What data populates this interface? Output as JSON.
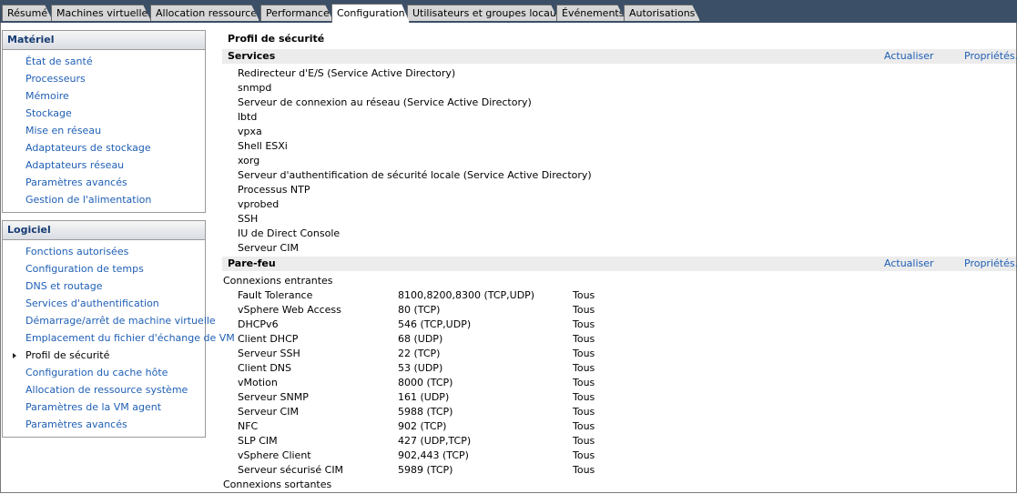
{
  "tabs": [
    {
      "label": "Résumé",
      "active": false
    },
    {
      "label": "Machines virtuelles",
      "active": false
    },
    {
      "label": "Allocation ressources",
      "active": false
    },
    {
      "label": "Performance",
      "active": false
    },
    {
      "label": "Configuration",
      "active": true
    },
    {
      "label": "Utilisateurs et groupes locaux",
      "active": false
    },
    {
      "label": "Événements",
      "active": false
    },
    {
      "label": "Autorisations",
      "active": false
    }
  ],
  "sidebar": {
    "hardware": {
      "title": "Matériel",
      "items": [
        "État de santé",
        "Processeurs",
        "Mémoire",
        "Stockage",
        "Mise en réseau",
        "Adaptateurs de stockage",
        "Adaptateurs réseau",
        "Paramètres avancés",
        "Gestion de l'alimentation"
      ]
    },
    "software": {
      "title": "Logiciel",
      "items": [
        "Fonctions autorisées",
        "Configuration de temps",
        "DNS et routage",
        "Services d'authentification",
        "Démarrage/arrêt de machine virtuelle",
        "Emplacement du fichier d'échange de VM",
        "Profil de sécurité",
        "Configuration du cache hôte",
        "Allocation de ressource système",
        "Paramètres de la VM agent",
        "Paramètres avancés"
      ],
      "selected_index": 6
    }
  },
  "content": {
    "title": "Profil de sécurité",
    "services": {
      "heading": "Services",
      "refresh_label": "Actualiser",
      "properties_label": "Propriétés...",
      "items": [
        "Redirecteur d'E/S (Service Active Directory)",
        "snmpd",
        "Serveur de connexion au réseau (Service Active Directory)",
        "lbtd",
        "vpxa",
        "Shell ESXi",
        "xorg",
        "Serveur d'authentification de sécurité locale (Service Active Directory)",
        "Processus NTP",
        "vprobed",
        "SSH",
        "IU de Direct Console",
        "Serveur CIM"
      ]
    },
    "firewall": {
      "heading": "Pare-feu",
      "refresh_label": "Actualiser",
      "properties_label": "Propriétés...",
      "incoming_label": "Connexions entrantes",
      "outgoing_label": "Connexions sortantes",
      "incoming": [
        {
          "name": "Fault Tolerance",
          "ports": "8100,8200,8300 (TCP,UDP)",
          "scope": "Tous"
        },
        {
          "name": "vSphere Web Access",
          "ports": "80 (TCP)",
          "scope": "Tous"
        },
        {
          "name": "DHCPv6",
          "ports": "546 (TCP,UDP)",
          "scope": "Tous"
        },
        {
          "name": "Client DHCP",
          "ports": "68 (UDP)",
          "scope": "Tous"
        },
        {
          "name": "Serveur SSH",
          "ports": "22 (TCP)",
          "scope": "Tous"
        },
        {
          "name": "Client DNS",
          "ports": "53 (UDP)",
          "scope": "Tous"
        },
        {
          "name": "vMotion",
          "ports": "8000 (TCP)",
          "scope": "Tous"
        },
        {
          "name": "Serveur SNMP",
          "ports": "161 (UDP)",
          "scope": "Tous"
        },
        {
          "name": "Serveur CIM",
          "ports": "5988 (TCP)",
          "scope": "Tous"
        },
        {
          "name": "NFC",
          "ports": "902 (TCP)",
          "scope": "Tous"
        },
        {
          "name": "SLP CIM",
          "ports": "427 (UDP,TCP)",
          "scope": "Tous"
        },
        {
          "name": "vSphere Client",
          "ports": "902,443 (TCP)",
          "scope": "Tous"
        },
        {
          "name": "Serveur sécurisé CIM",
          "ports": "5989 (TCP)",
          "scope": "Tous"
        }
      ]
    }
  }
}
